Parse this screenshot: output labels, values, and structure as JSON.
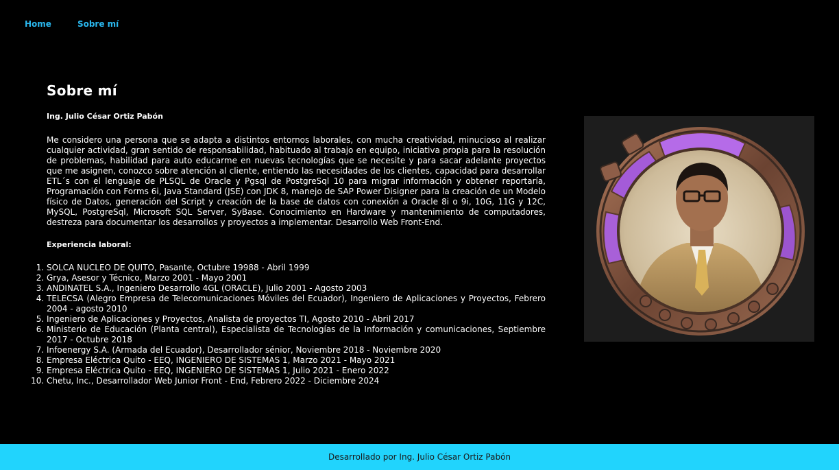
{
  "nav": {
    "items": [
      {
        "label": "Home"
      },
      {
        "label": "Sobre mí"
      }
    ]
  },
  "main": {
    "title": "Sobre mí",
    "name": "Ing. Julio César Ortiz Pabón",
    "bio": "Me considero una persona que se adapta a distintos entornos laborales, con mucha creatividad, minucioso al realizar cualquier actividad, gran sentido de responsabilidad, habituado al trabajo en equipo, iniciativa propia para la resolución de problemas, habilidad para auto educarme en nuevas tecnologías que se necesite y para sacar adelante proyectos que me asignen, conozco sobre atención al cliente, entiendo las necesidades de los clientes, capacidad para desarrollar ETL´s con el lenguaje de PLSQL de Oracle y Pgsql de PostgreSql 10 para migrar información y obtener reportaría, Programación con Forms 6i, Java Standard (JSE) con JDK 8, manejo de SAP Power Disigner para la creación de un Modelo físico de Datos, generación del Script y creación de la base de datos con conexión a Oracle 8i o 9i, 10G, 11G y 12C, MySQL, PostgreSql, Microsoft SQL Server, SyBase. Conocimiento en Hardware y mantenimiento de computadores, destreza para documentar los desarrollos y proyectos a implementar. Desarrollo Web Front-End.",
    "experience_title": "Experiencia laboral:",
    "experience": [
      "SOLCA NUCLEO DE QUITO, Pasante, Octubre 19988 - Abril 1999",
      "Grya, Asesor y Técnico, Marzo 2001 - Mayo 2001",
      "ANDINATEL S.A., Ingeniero Desarrollo 4GL (ORACLE), Julio 2001 - Agosto 2003",
      "TELECSA (Alegro Empresa de Telecomunicaciones Móviles del Ecuador), Ingeniero de Aplicaciones y Proyectos, Febrero 2004 - agosto 2010",
      "Ingeniero de Aplicaciones y Proyectos, Analista de proyectos TI, Agosto 2010 - Abril 2017",
      "Ministerio de Educación (Planta central), Especialista de Tecnologías de la Información y comunicaciones, Septiembre 2017 - Octubre 2018",
      "Infoenergy S.A. (Armada del Ecuador), Desarrollador sénior, Noviembre 2018 - Noviembre 2020",
      "Empresa Eléctrica Quito - EEQ, INGENIERO DE SISTEMAS 1, Marzo 2021 - Mayo 2021",
      "Empresa Eléctrica Quito - EEQ, INGENIERO DE SISTEMAS 1, Julio 2021 - Enero 2022",
      "Chetu, Inc., Desarrollador Web Junior Front - End, Febrero 2022 - Diciembre 2024"
    ]
  },
  "footer": {
    "text": "Desarrollado por Ing. Julio César Ortiz Pabón"
  },
  "colors": {
    "background": "#000000",
    "nav_link": "#2ab8ef",
    "footer_bg": "#21d4fd",
    "frame_bronze": "#8a5a42",
    "frame_purple": "#b56be8"
  }
}
